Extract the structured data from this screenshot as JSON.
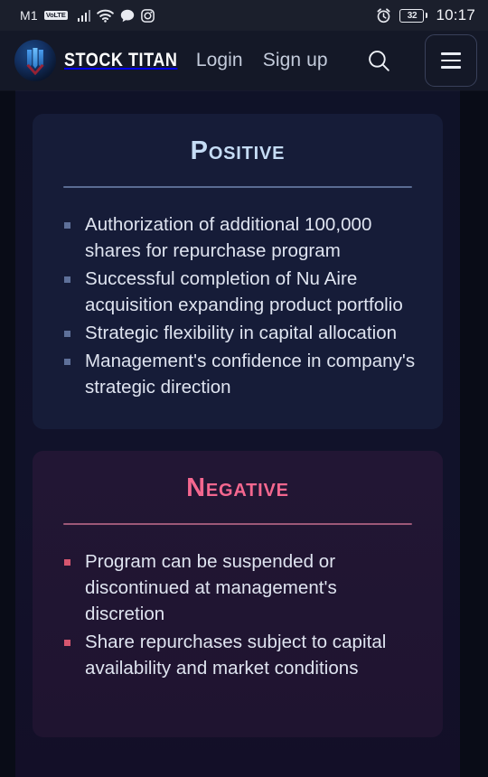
{
  "status_bar": {
    "carrier": "M1",
    "network_badge": "VoLTE",
    "icons": [
      "signal-bars-icon",
      "wifi-icon",
      "chat-bubble-icon",
      "instagram-icon",
      "alarm-clock-icon"
    ],
    "battery_level": "32",
    "time": "10:17"
  },
  "header": {
    "logo_icon": "stock-titan-logo-icon",
    "brand_name": "STOCK TITAN",
    "nav": [
      {
        "label": "Login",
        "name": "login-link"
      },
      {
        "label": "Sign up",
        "name": "signup-link"
      }
    ],
    "search_icon": "search-icon",
    "menu_icon": "hamburger-menu-icon"
  },
  "cards": [
    {
      "title": "Positive",
      "accent_color": "#c5dcf5",
      "bullets": [
        "Authorization of additional 100,000 shares for repurchase program",
        "Successful completion of Nu Aire acquisition expanding product portfolio",
        "Strategic flexibility in capital allocation",
        "Management's confidence in company's strategic direction"
      ]
    },
    {
      "title": "Negative",
      "accent_color": "#f4678f",
      "bullets": [
        "Program can be suspended or discontinued at management's discretion",
        "Share repurchases subject to capital availability and market conditions"
      ]
    }
  ]
}
